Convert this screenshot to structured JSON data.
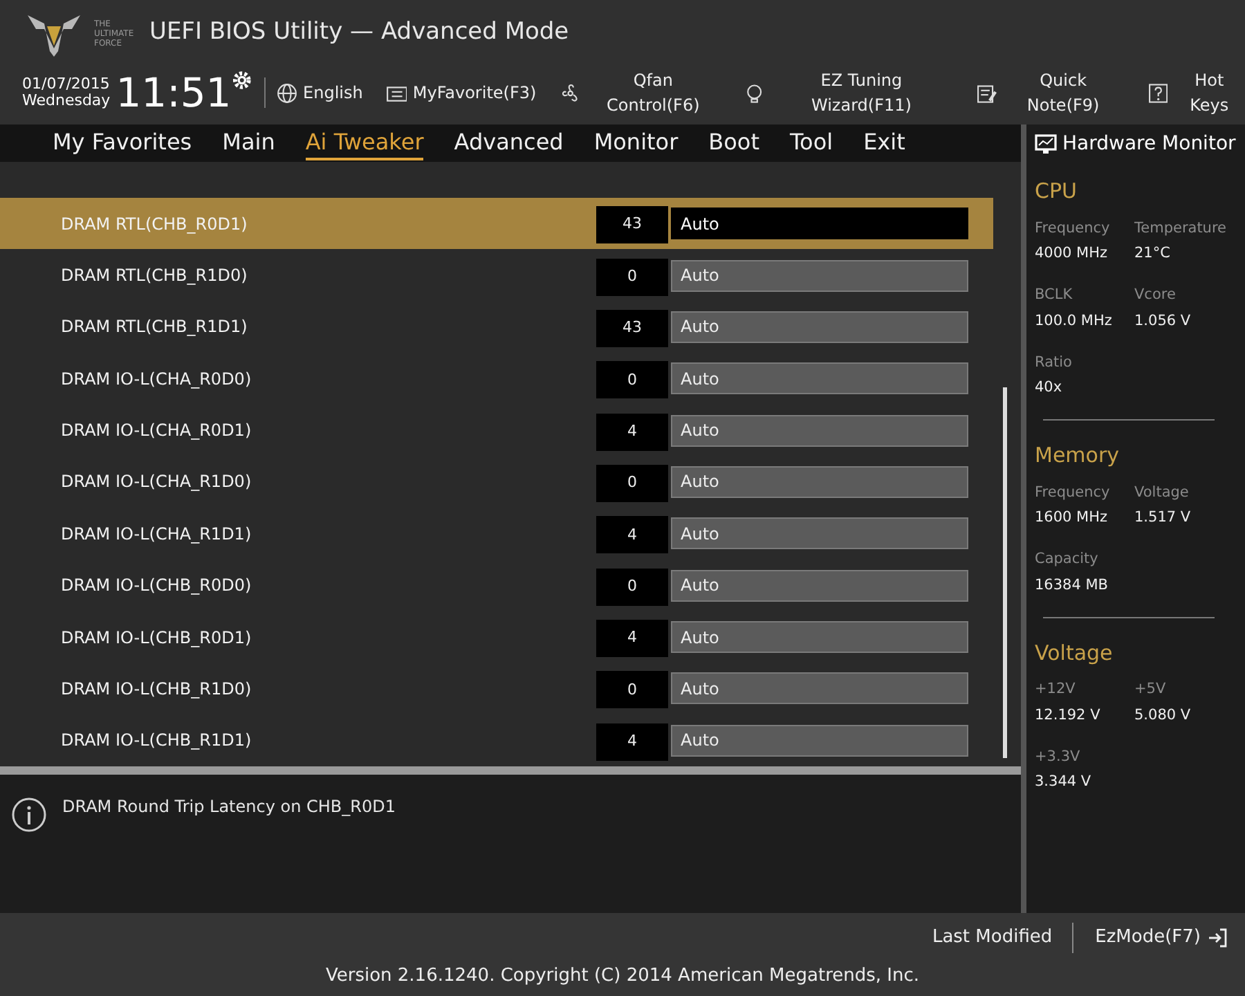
{
  "window": {
    "title": "UEFI BIOS Utility — Advanced Mode"
  },
  "logo": {
    "text": "THE ULTIMATE FORCE"
  },
  "clock": {
    "date": "01/07/2015",
    "day": "Wednesday",
    "time": "11:51"
  },
  "toolbar": [
    {
      "kind": "globe",
      "label": "English"
    },
    {
      "kind": "folder",
      "label": "MyFavorite(F3)"
    },
    {
      "kind": "fan",
      "label": "Qfan Control(F6)"
    },
    {
      "kind": "bulb",
      "label": "EZ Tuning Wizard(F11)"
    },
    {
      "kind": "note",
      "label": "Quick Note(F9)"
    },
    {
      "kind": "help",
      "label": "Hot Keys"
    }
  ],
  "tabs": [
    {
      "label": "My Favorites",
      "selected": false
    },
    {
      "label": "Main",
      "selected": false
    },
    {
      "label": "Ai Tweaker",
      "selected": true
    },
    {
      "label": "Advanced",
      "selected": false
    },
    {
      "label": "Monitor",
      "selected": false
    },
    {
      "label": "Boot",
      "selected": false
    },
    {
      "label": "Tool",
      "selected": false
    },
    {
      "label": "Exit",
      "selected": false
    }
  ],
  "settings": [
    {
      "label": "DRAM RTL(CHB_R0D1)",
      "value": "43",
      "option": "Auto",
      "selected": true
    },
    {
      "label": "DRAM RTL(CHB_R1D0)",
      "value": "0",
      "option": "Auto",
      "selected": false
    },
    {
      "label": "DRAM RTL(CHB_R1D1)",
      "value": "43",
      "option": "Auto",
      "selected": false
    },
    {
      "label": "DRAM IO-L(CHA_R0D0)",
      "value": "0",
      "option": "Auto",
      "selected": false
    },
    {
      "label": "DRAM IO-L(CHA_R0D1)",
      "value": "4",
      "option": "Auto",
      "selected": false
    },
    {
      "label": "DRAM IO-L(CHA_R1D0)",
      "value": "0",
      "option": "Auto",
      "selected": false
    },
    {
      "label": "DRAM IO-L(CHA_R1D1)",
      "value": "4",
      "option": "Auto",
      "selected": false
    },
    {
      "label": "DRAM IO-L(CHB_R0D0)",
      "value": "0",
      "option": "Auto",
      "selected": false
    },
    {
      "label": "DRAM IO-L(CHB_R0D1)",
      "value": "4",
      "option": "Auto",
      "selected": false
    },
    {
      "label": "DRAM IO-L(CHB_R1D0)",
      "value": "0",
      "option": "Auto",
      "selected": false
    },
    {
      "label": "DRAM IO-L(CHB_R1D1)",
      "value": "4",
      "option": "Auto",
      "selected": false
    }
  ],
  "help_text": "DRAM Round Trip Latency on CHB_R0D1",
  "hardware_monitor": {
    "title": "Hardware Monitor",
    "sections": [
      {
        "title": "CPU",
        "fields": [
          {
            "label": "Frequency",
            "value": "4000 MHz"
          },
          {
            "label": "Temperature",
            "value": "21°C"
          },
          {
            "label": "BCLK",
            "value": "100.0 MHz"
          },
          {
            "label": "Vcore",
            "value": "1.056 V"
          },
          {
            "label": "Ratio",
            "value": "40x"
          }
        ]
      },
      {
        "title": "Memory",
        "fields": [
          {
            "label": "Frequency",
            "value": "1600 MHz"
          },
          {
            "label": "Voltage",
            "value": "1.517 V"
          },
          {
            "label": "Capacity",
            "value": "16384 MB"
          }
        ]
      },
      {
        "title": "Voltage",
        "fields": [
          {
            "label": "+12V",
            "value": "12.192 V"
          },
          {
            "label": "+5V",
            "value": "5.080 V"
          },
          {
            "label": "+3.3V",
            "value": "3.344 V"
          }
        ]
      }
    ]
  },
  "footer": {
    "last_modified": "Last Modified",
    "ez_mode": "EzMode(F7)",
    "version": "Version 2.16.1240. Copyright (C) 2014 American Megatrends, Inc."
  }
}
